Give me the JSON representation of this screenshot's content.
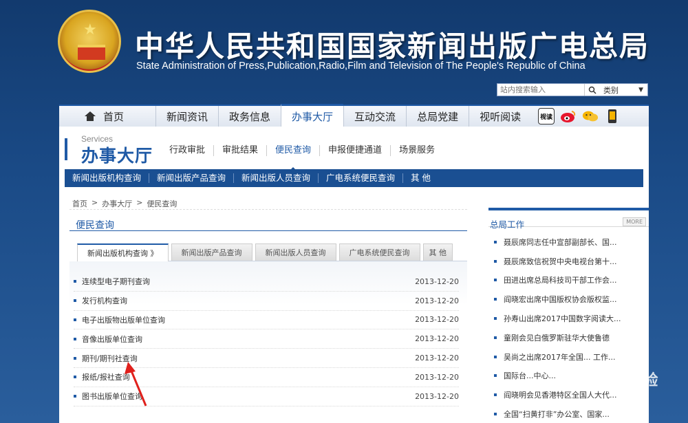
{
  "header": {
    "title_zh": "中华人民共和国国家新闻出版广电总局",
    "title_en": "State Administration of Press,Publication,Radio,Film and Television of The People's Republic of China",
    "search_placeholder": "站内搜索输入",
    "search_category": "类别"
  },
  "main_nav": {
    "home": "首页",
    "items": [
      "新闻资讯",
      "政务信息",
      "办事大厅",
      "互动交流",
      "总局党建",
      "视听阅读"
    ],
    "active": "办事大厅",
    "icons": [
      "视读",
      "weibo-icon",
      "wechat-icon",
      "mobile-icon"
    ]
  },
  "section": {
    "services_label": "Services",
    "title": "办事大厅",
    "sub_nav": [
      "行政审批",
      "审批结果",
      "便民查询",
      "申报便捷通道",
      "场景服务"
    ],
    "sub_nav_active": "便民查询",
    "blue_bar": [
      "新闻出版机构查询",
      "新闻出版产品查询",
      "新闻出版人员查询",
      "广电系统便民查询",
      "其 他"
    ]
  },
  "breadcrumb": [
    "首页",
    ">",
    "办事大厅",
    ">",
    "便民查询"
  ],
  "left": {
    "title": "便民查询",
    "tabs": [
      "新闻出版机构查询 》",
      "新闻出版产品查询",
      "新闻出版人员查询",
      "广电系统便民查询",
      "其 他"
    ],
    "rows": [
      {
        "label": "连续型电子期刊查询",
        "date": "2013-12-20"
      },
      {
        "label": "发行机构查询",
        "date": "2013-12-20"
      },
      {
        "label": "电子出版物出版单位查询",
        "date": "2013-12-20"
      },
      {
        "label": "音像出版单位查询",
        "date": "2013-12-20"
      },
      {
        "label": "期刊/期刊社查询",
        "date": "2013-12-20"
      },
      {
        "label": "报纸/报社查询",
        "date": "2013-12-20"
      },
      {
        "label": "图书出版单位查询",
        "date": "2013-12-20"
      }
    ]
  },
  "right": {
    "title": "总局工作",
    "more": "MORE",
    "news": [
      "聂辰席同志任中宣部副部长、国...",
      "聂辰席致信祝贺中央电视台第十...",
      "田进出席总局科技司干部工作会...",
      "阎晓宏出席中国版权协会版权监...",
      "孙寿山出席2017中国数字阅读大...",
      "童刚会见白俄罗斯驻华大使鲁德",
      "吴尚之出席2017年全国... 工作...",
      "国际台...中心...",
      "阎晓明会见香港特区全国人大代...",
      "全国“扫黄打非”办公室、国家..."
    ]
  },
  "watermark": "Bai 经验"
}
